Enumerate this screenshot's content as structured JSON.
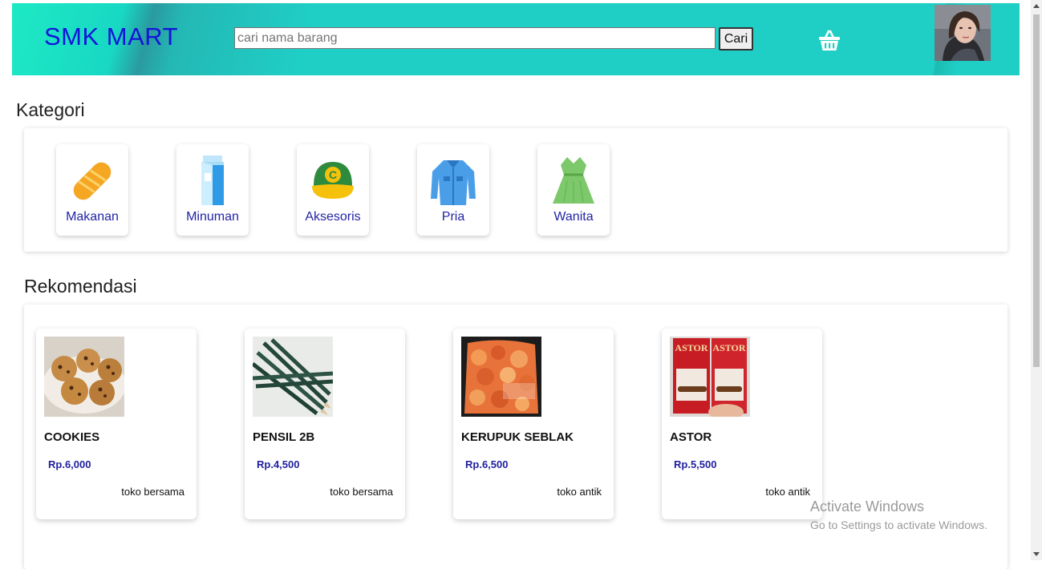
{
  "header": {
    "brand": "SMK MART",
    "search_placeholder": "cari nama barang",
    "search_button": "Cari",
    "cart_icon": "shopping-basket-icon",
    "colors": {
      "gradient_light": "#1de9c4",
      "gradient_main": "#1fcfc6",
      "brand_text": "#1414d9"
    }
  },
  "kategori": {
    "title": "Kategori",
    "items": [
      {
        "label": "Makanan",
        "icon": "bread-icon"
      },
      {
        "label": "Minuman",
        "icon": "milk-carton-icon"
      },
      {
        "label": "Aksesoris",
        "icon": "cap-icon"
      },
      {
        "label": "Pria",
        "icon": "shirt-icon"
      },
      {
        "label": "Wanita",
        "icon": "dress-icon"
      }
    ]
  },
  "rekomendasi": {
    "title": "Rekomendasi",
    "products": [
      {
        "name": "COOKIES",
        "price": "Rp.6,000",
        "store": "toko bersama",
        "image": "cookies-image"
      },
      {
        "name": "PENSIL 2B",
        "price": "Rp.4,500",
        "store": "toko bersama",
        "image": "pencils-image"
      },
      {
        "name": "KERUPUK SEBLAK",
        "price": "Rp.6,500",
        "store": "toko antik",
        "image": "kerupuk-image"
      },
      {
        "name": "ASTOR",
        "price": "Rp.5,500",
        "store": "toko antik",
        "image": "astor-image"
      }
    ]
  },
  "watermark": {
    "title": "Activate Windows",
    "subtitle": "Go to Settings to activate Windows."
  }
}
